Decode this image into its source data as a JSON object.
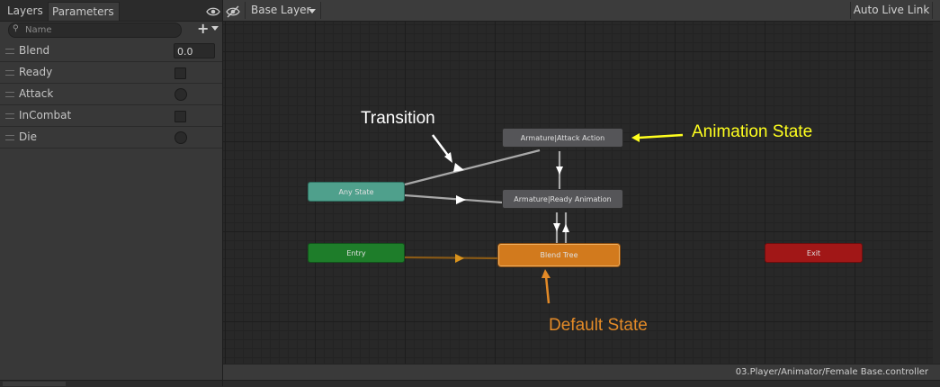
{
  "tabs": {
    "layers": "Layers",
    "parameters": "Parameters"
  },
  "search": {
    "placeholder": "Name"
  },
  "parameters": [
    {
      "name": "Blend",
      "type": "float",
      "value": "0.0"
    },
    {
      "name": "Ready",
      "type": "bool",
      "value": false
    },
    {
      "name": "Attack",
      "type": "trigger",
      "value": false
    },
    {
      "name": "InCombat",
      "type": "bool",
      "value": false
    },
    {
      "name": "Die",
      "type": "trigger",
      "value": false
    }
  ],
  "toolbar": {
    "layer": "Base Layer",
    "live_link": "Auto Live Link"
  },
  "nodes": {
    "attack": "Armature|Attack Action",
    "ready": "Armature|Ready Animation",
    "any": "Any State",
    "entry": "Entry",
    "blend": "Blend Tree",
    "exit": "Exit"
  },
  "annotations": {
    "transition": "Transition",
    "animation_state": "Animation State",
    "default_state": "Default State"
  },
  "status": {
    "path": "03.Player/Animator/Female Base.controller"
  },
  "colors": {
    "node_default": "#555558",
    "any_state": "#4fa08c",
    "entry": "#1e7d2a",
    "default_state": "#d27a1d",
    "exit": "#a11717",
    "annot_white": "#ffffff",
    "annot_yellow": "#ffff1e",
    "annot_orange": "#e38a27"
  }
}
